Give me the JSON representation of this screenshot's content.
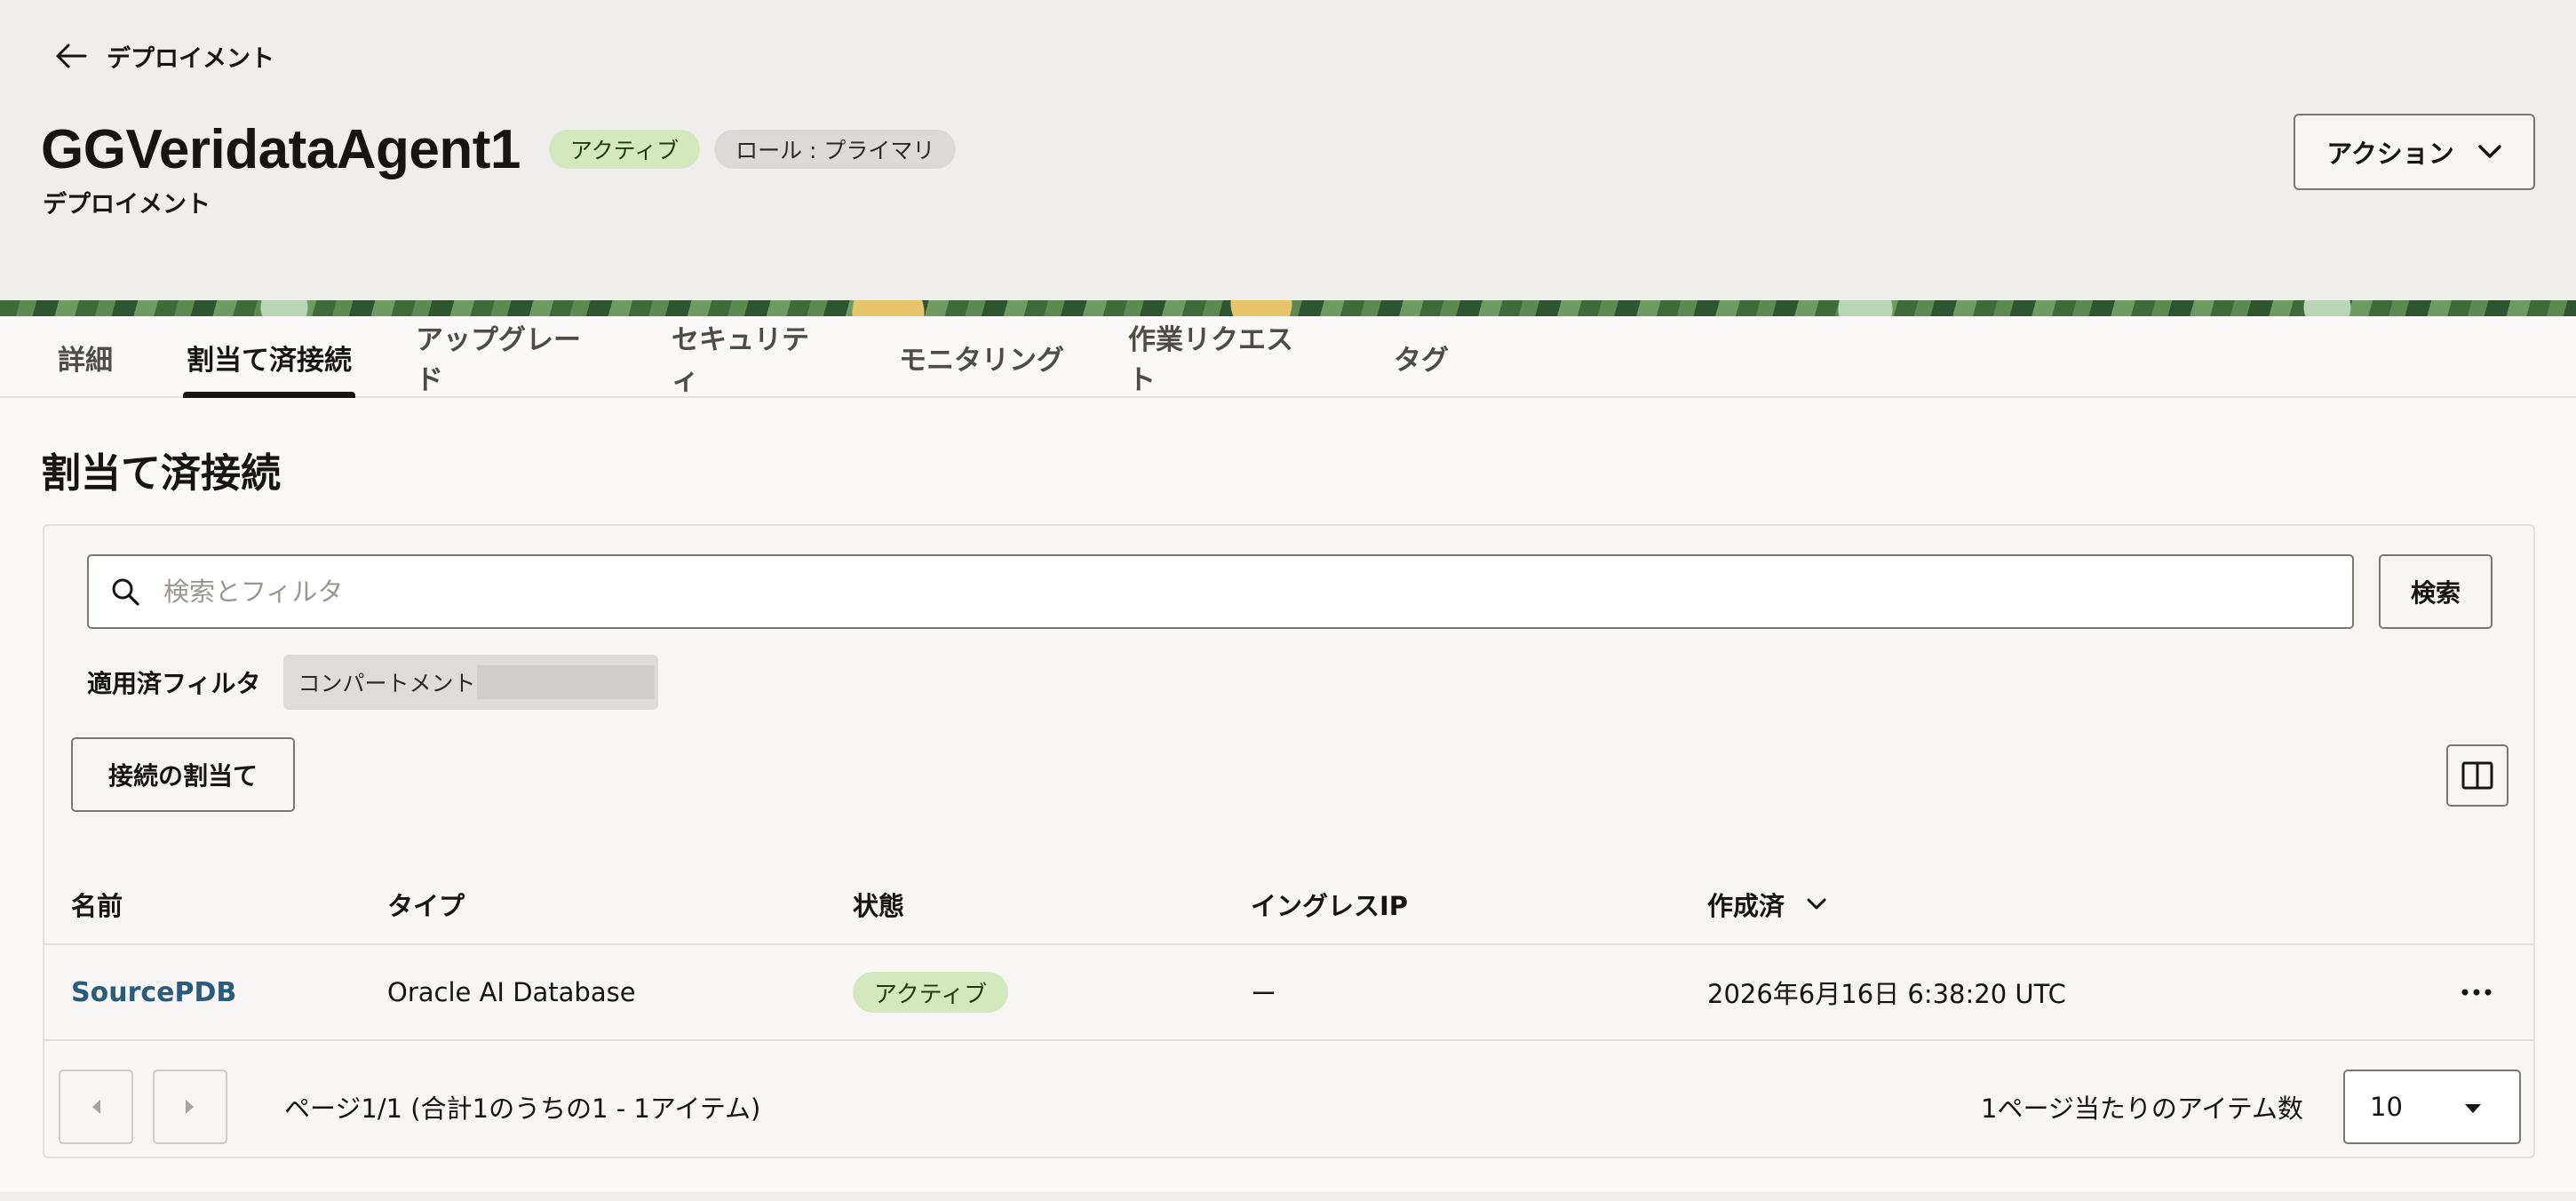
{
  "header": {
    "back_label": "デプロイメント",
    "title": "GGVeridataAgent1",
    "status_badge": "アクティブ",
    "role_badge": "ロール : プライマリ",
    "subtitle": "デプロイメント",
    "actions_label": "アクション"
  },
  "tabs": [
    {
      "label": "詳細",
      "selected": false
    },
    {
      "label": "割当て済接続",
      "selected": true
    },
    {
      "label": "アップグレード",
      "selected": false
    },
    {
      "label": "セキュリティ",
      "selected": false
    },
    {
      "label": "モニタリング",
      "selected": false
    },
    {
      "label": "作業リクエスト",
      "selected": false
    },
    {
      "label": "タグ",
      "selected": false
    }
  ],
  "section": {
    "title": "割当て済接続",
    "search_placeholder": "検索とフィルタ",
    "search_button": "検索",
    "applied_filters_label": "適用済フィルタ",
    "filter_chip": "コンパートメント",
    "assign_button": "接続の割当て"
  },
  "table": {
    "columns": [
      "名前",
      "タイプ",
      "状態",
      "イングレスIP",
      "作成済"
    ],
    "rows": [
      {
        "name": "SourcePDB",
        "type": "Oracle AI Database",
        "state": "アクティブ",
        "ingress_ip": "ー",
        "created": "2026年6月16日 6:38:20 UTC"
      }
    ]
  },
  "pagination": {
    "info": "ページ1/1 (合計1のうちの1 - 1アイテム)",
    "per_page_label": "1ページ当たりのアイテム数",
    "per_page_value": "10"
  },
  "icons": {
    "back": "arrow-left-icon",
    "actions": "chevron-down-icon",
    "search": "search-icon",
    "columns": "column-layout-icon",
    "sort": "chevron-down-icon",
    "row_menu": "more-horizontal-icon",
    "prev": "caret-left-icon",
    "next": "caret-right-icon",
    "select": "caret-down-icon"
  },
  "colors": {
    "accent_link": "#2c5a7a",
    "active_badge_bg": "#d4e8be",
    "header_bg": "#efeeec"
  }
}
